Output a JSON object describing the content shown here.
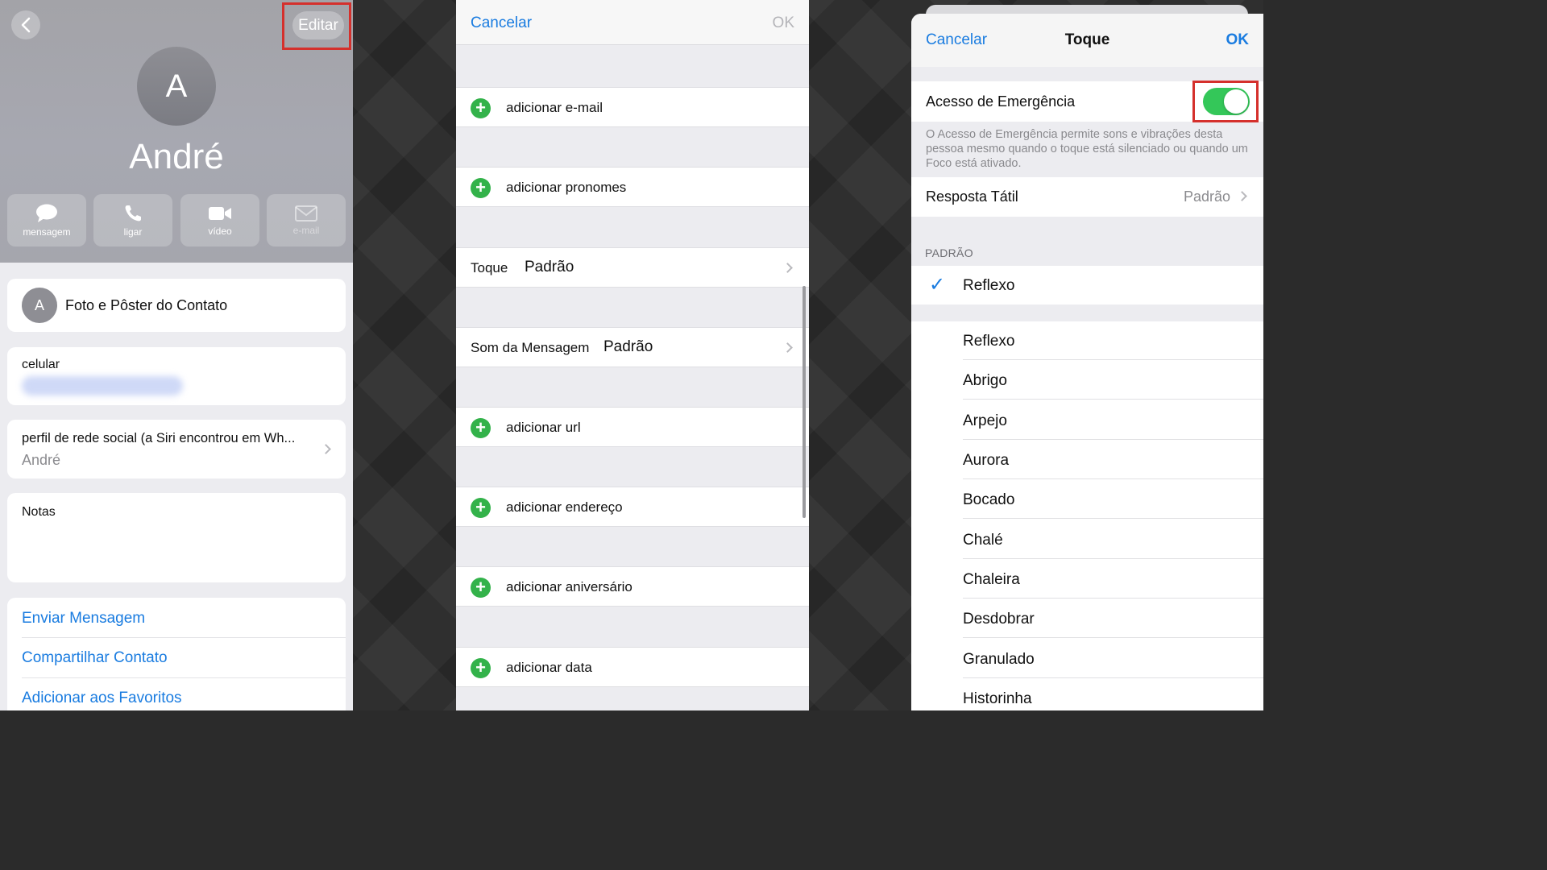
{
  "panel1": {
    "edit_label": "Editar",
    "avatar_initial": "A",
    "contact_name": "André",
    "actions": [
      {
        "label": "mensagem",
        "icon": "message-icon"
      },
      {
        "label": "ligar",
        "icon": "phone-icon"
      },
      {
        "label": "vídeo",
        "icon": "video-icon"
      },
      {
        "label": "e-mail",
        "icon": "mail-icon"
      }
    ],
    "photo_poster": "Foto e Pôster do Contato",
    "phone_label": "celular",
    "social_label": "perfil de rede social (a Siri encontrou em Wh...",
    "social_value": "André",
    "notes_label": "Notas",
    "links": [
      "Enviar Mensagem",
      "Compartilhar Contato",
      "Adicionar aos Favoritos"
    ]
  },
  "panel2": {
    "cancel": "Cancelar",
    "ok": "OK",
    "add_email": "adicionar e-mail",
    "add_pronouns": "adicionar pronomes",
    "ringtone_key": "Toque",
    "ringtone_value": "Padrão",
    "msg_sound_key": "Som da Mensagem",
    "msg_sound_value": "Padrão",
    "add_url": "adicionar url",
    "add_address": "adicionar endereço",
    "add_birthday": "adicionar aniversário",
    "add_date": "adicionar data"
  },
  "panel3": {
    "cancel": "Cancelar",
    "title": "Toque",
    "ok": "OK",
    "emergency_label": "Acesso de Emergência",
    "emergency_on": true,
    "emergency_desc": "O Acesso de Emergência permite sons e vibrações desta pessoa mesmo quando o toque está silenciado ou quando um Foco está ativado.",
    "haptic_label": "Resposta Tátil",
    "haptic_value": "Padrão",
    "section_header": "PADRÃO",
    "default_tone": "Reflexo",
    "tones": [
      "Reflexo",
      "Abrigo",
      "Arpejo",
      "Aurora",
      "Bocado",
      "Chalé",
      "Chaleira",
      "Desdobrar",
      "Granulado",
      "Historinha"
    ]
  },
  "colors": {
    "accent": "#1a7ce0",
    "highlight": "#d5302c",
    "toggle_on": "#34c759",
    "add_green": "#33b24a"
  }
}
